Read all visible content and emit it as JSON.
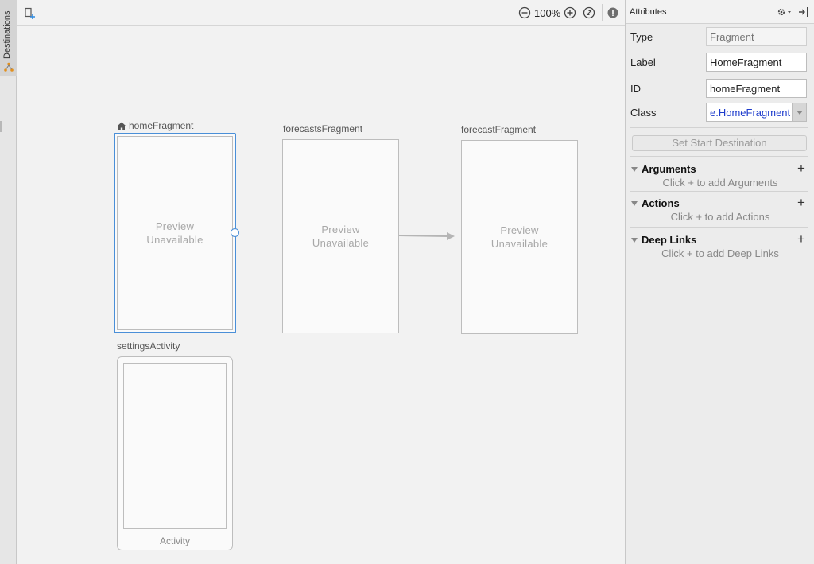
{
  "left_strip": {
    "destinations_tab": "Destinations"
  },
  "toolbar": {
    "zoom_level": "100%"
  },
  "graph": {
    "destinations": [
      {
        "label": "homeFragment",
        "preview_line1": "Preview",
        "preview_line2": "Unavailable",
        "is_start": true,
        "selected": true
      },
      {
        "label": "forecastsFragment",
        "preview_line1": "Preview",
        "preview_line2": "Unavailable"
      },
      {
        "label": "forecastFragment",
        "preview_line1": "Preview",
        "preview_line2": "Unavailable"
      }
    ],
    "activity": {
      "label": "settingsActivity",
      "footer": "Activity"
    },
    "actions": [
      {
        "from": "forecastsFragment",
        "to": "forecastFragment"
      }
    ]
  },
  "attributes": {
    "panel_title": "Attributes",
    "type_label": "Type",
    "type_placeholder": "Fragment",
    "label_label": "Label",
    "label_value": "HomeFragment",
    "id_label": "ID",
    "id_value": "homeFragment",
    "class_label": "Class",
    "class_value": "e.HomeFragment",
    "start_button": "Set Start Destination",
    "sections": [
      {
        "title": "Arguments",
        "hint": "Click + to add Arguments"
      },
      {
        "title": "Actions",
        "hint": "Click + to add Actions"
      },
      {
        "title": "Deep Links",
        "hint": "Click + to add Deep Links"
      }
    ]
  },
  "colors": {
    "selection": "#4a8fd8",
    "class_text": "#1e3ccc"
  }
}
